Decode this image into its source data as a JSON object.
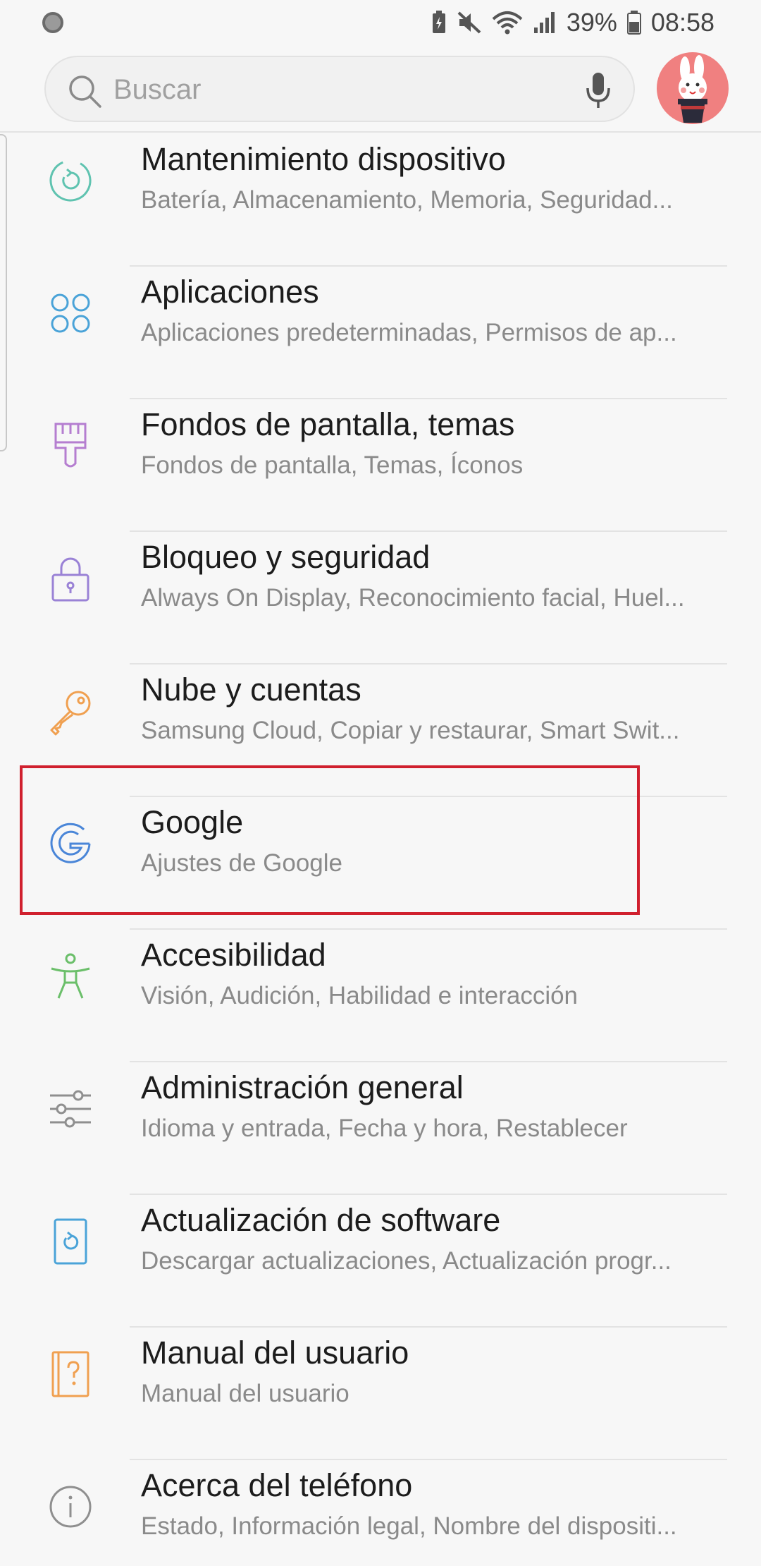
{
  "status_bar": {
    "battery_percent": "39%",
    "time": "08:58"
  },
  "search": {
    "placeholder": "Buscar"
  },
  "colors": {
    "highlight": "#d0202e",
    "avatar_bg": "#f08080"
  },
  "settings": [
    {
      "title": "Mantenimiento dispositivo",
      "subtitle": "Batería, Almacenamiento, Memoria, Seguridad...",
      "icon": "device-care-icon"
    },
    {
      "title": "Aplicaciones",
      "subtitle": "Aplicaciones predeterminadas, Permisos de ap...",
      "icon": "apps-icon"
    },
    {
      "title": "Fondos de pantalla, temas",
      "subtitle": "Fondos de pantalla, Temas, Íconos",
      "icon": "paintbrush-icon"
    },
    {
      "title": "Bloqueo y seguridad",
      "subtitle": "Always On Display, Reconocimiento facial, Huel...",
      "icon": "lock-icon"
    },
    {
      "title": "Nube y cuentas",
      "subtitle": "Samsung Cloud, Copiar y restaurar, Smart Swit...",
      "icon": "key-icon"
    },
    {
      "title": "Google",
      "subtitle": "Ajustes de Google",
      "icon": "google-icon"
    },
    {
      "title": "Accesibilidad",
      "subtitle": "Visión, Audición, Habilidad e interacción",
      "icon": "accessibility-icon"
    },
    {
      "title": "Administración general",
      "subtitle": "Idioma y entrada, Fecha y hora, Restablecer",
      "icon": "sliders-icon"
    },
    {
      "title": "Actualización de software",
      "subtitle": "Descargar actualizaciones, Actualización progr...",
      "icon": "software-update-icon"
    },
    {
      "title": "Manual del usuario",
      "subtitle": "Manual del usuario",
      "icon": "user-manual-icon"
    },
    {
      "title": "Acerca del teléfono",
      "subtitle": "Estado, Información legal, Nombre del dispositi...",
      "icon": "info-icon"
    }
  ]
}
